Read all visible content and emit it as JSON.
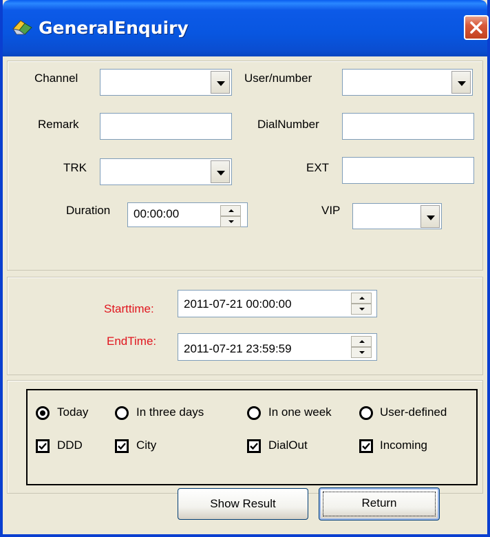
{
  "window": {
    "title": "GeneralEnquiry"
  },
  "filters": {
    "channel_label": "Channel",
    "user_number_label": "User/number",
    "remark_label": "Remark",
    "dial_number_label": "DialNumber",
    "trk_label": "TRK",
    "ext_label": "EXT",
    "duration_label": "Duration",
    "duration_value": "00:00:00",
    "vip_label": "VIP"
  },
  "time": {
    "start_label": "Starttime:",
    "start_value": "2011-07-21 00:00:00",
    "end_label": "EndTime:",
    "end_value": "2011-07-21 23:59:59"
  },
  "options": {
    "radios": [
      {
        "label": "Today",
        "selected": true
      },
      {
        "label": "In three days",
        "selected": false
      },
      {
        "label": "In one week",
        "selected": false
      },
      {
        "label": "User-defined",
        "selected": false
      }
    ],
    "checks": [
      {
        "label": "DDD",
        "checked": true
      },
      {
        "label": "City",
        "checked": true
      },
      {
        "label": "DialOut",
        "checked": true
      },
      {
        "label": "Incoming",
        "checked": true
      }
    ]
  },
  "buttons": {
    "show_result": "Show Result",
    "return": "Return"
  },
  "colors": {
    "titlebar": "#0856e0",
    "required_label": "#e0151e",
    "face": "#ece9d8"
  }
}
